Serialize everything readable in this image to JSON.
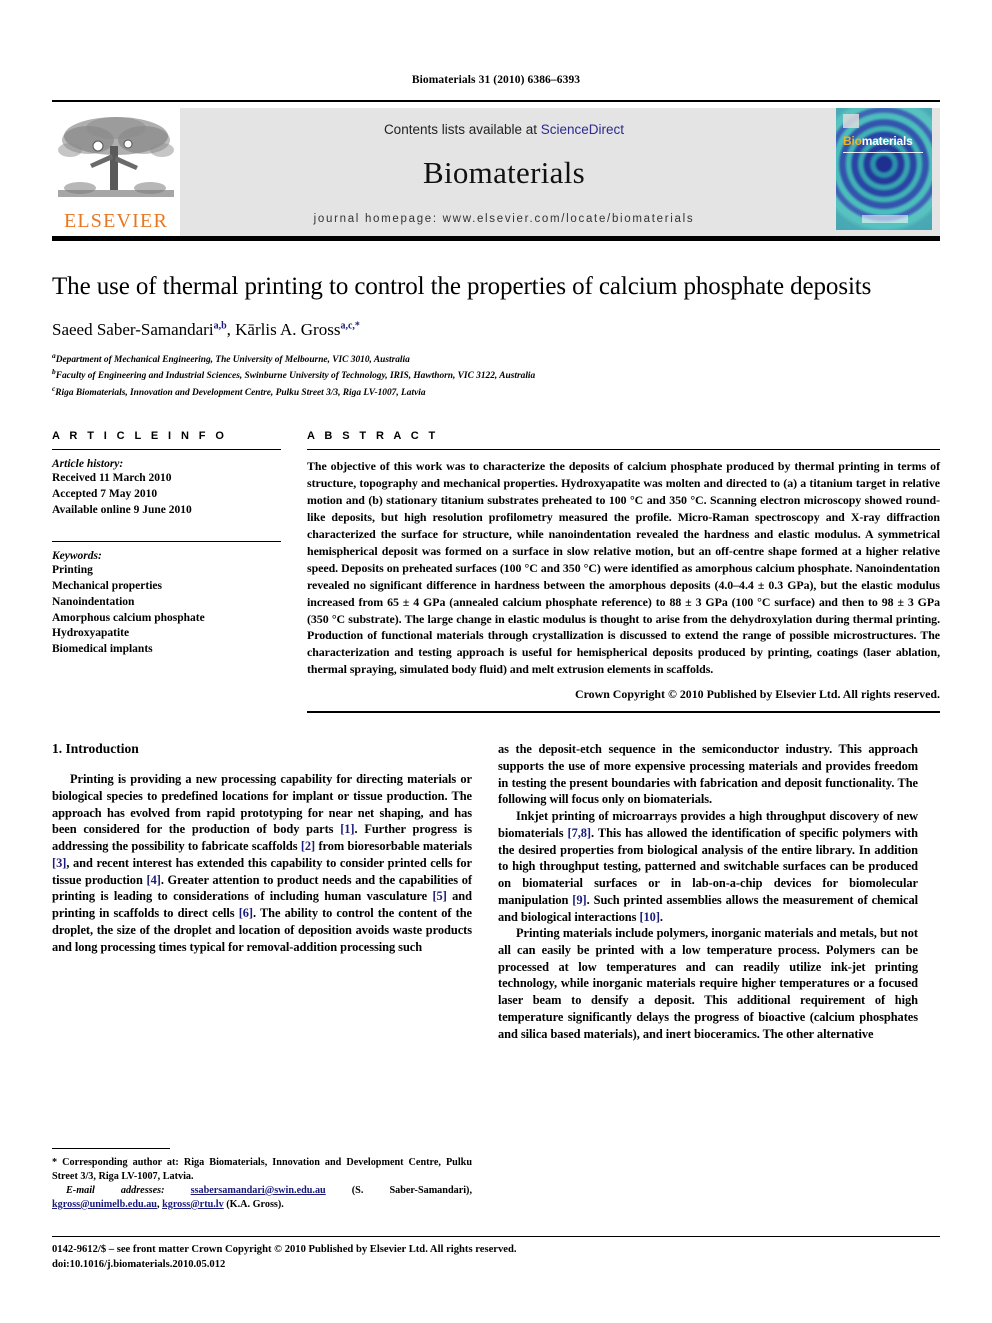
{
  "running_head": "Biomaterials 31 (2010) 6386–6393",
  "masthead": {
    "publisher_wordmark": "ELSEVIER",
    "contents_prefix": "Contents lists available at ",
    "contents_link": "ScienceDirect",
    "journal_title": "Biomaterials",
    "homepage_line": "journal homepage: www.elsevier.com/locate/biomaterials",
    "cover": {
      "title_part1": "Bio",
      "title_part2": "materials"
    },
    "accent_link_color": "#2b2b8f",
    "elsevier_orange": "#E87722",
    "banner_bg": "#e4e4e4"
  },
  "article": {
    "title": "The use of thermal printing to control the properties of calcium phosphate deposits",
    "authors_part1": "Saeed Saber-Samandari",
    "authors_sup1": "a,b",
    "authors_sep": ", ",
    "authors_part2": "Kārlis A. Gross",
    "authors_sup2": "a,c,*",
    "affiliations": [
      {
        "marker": "a",
        "text": "Department of Mechanical Engineering, The University of Melbourne, VIC 3010, Australia"
      },
      {
        "marker": "b",
        "text": "Faculty of Engineering and Industrial Sciences, Swinburne University of Technology, IRIS, Hawthorn, VIC 3122, Australia"
      },
      {
        "marker": "c",
        "text": "Riga Biomaterials, Innovation and Development Centre, Pulku Street 3/3, Riga LV-1007, Latvia"
      }
    ]
  },
  "article_info": {
    "kicker": "A R T I C L E   I N F O",
    "history_head": "Article history:",
    "history": [
      "Received 11 March 2010",
      "Accepted 7 May 2010",
      "Available online 9 June 2010"
    ],
    "keywords_head": "Keywords:",
    "keywords": [
      "Printing",
      "Mechanical properties",
      "Nanoindentation",
      "Amorphous calcium phosphate",
      "Hydroxyapatite",
      "Biomedical implants"
    ]
  },
  "abstract": {
    "kicker": "A B S T R A C T",
    "text": "The objective of this work was to characterize the deposits of calcium phosphate produced by thermal printing in terms of structure, topography and mechanical properties. Hydroxyapatite was molten and directed to (a) a titanium target in relative motion and (b) stationary titanium substrates preheated to 100 °C and 350 °C. Scanning electron microscopy showed round-like deposits, but high resolution profilometry measured the profile. Micro-Raman spectroscopy and X-ray diffraction characterized the surface for structure, while nanoindentation revealed the hardness and elastic modulus. A symmetrical hemispherical deposit was formed on a surface in slow relative motion, but an off-centre shape formed at a higher relative speed. Deposits on preheated surfaces (100 °C and 350 °C) were identified as amorphous calcium phosphate. Nanoindentation revealed no significant difference in hardness between the amorphous deposits (4.0–4.4 ± 0.3 GPa), but the elastic modulus increased from 65 ± 4 GPa (annealed calcium phosphate reference) to 88 ± 3 GPa (100 °C surface) and then to 98 ± 3 GPa (350 °C substrate). The large change in elastic modulus is thought to arise from the dehydroxylation during thermal printing. Production of functional materials through crystallization is discussed to extend the range of possible microstructures. The characterization and testing approach is useful for hemispherical deposits produced by printing, coatings (laser ablation, thermal spraying, simulated body fluid) and melt extrusion elements in scaffolds.",
    "copyright": "Crown Copyright © 2010 Published by Elsevier Ltd. All rights reserved."
  },
  "introduction": {
    "heading": "1. Introduction",
    "left_paragraph_1_a": "Printing is providing a new processing capability for directing materials or biological species to predefined locations for implant or tissue production. The approach has evolved from rapid prototyping for near net shaping, and has been considered for the production of body parts ",
    "ref1": "[1]",
    "left_paragraph_1_b": ". Further progress is addressing the possibility to fabricate scaffolds ",
    "ref2": "[2]",
    "left_paragraph_1_c": " from bioresorbable materials ",
    "ref3": "[3]",
    "left_paragraph_1_d": ", and recent interest has extended this capability to consider printed cells for tissue production ",
    "ref4": "[4]",
    "left_paragraph_1_e": ". Greater attention to product needs and the capabilities of printing is leading to considerations of including human vasculature ",
    "ref5": "[5]",
    "left_paragraph_1_f": " and printing in scaffolds to direct cells ",
    "ref6": "[6]",
    "left_paragraph_1_g": ". The ability to control the content of the droplet, the size of the droplet and location of deposition avoids waste products and long processing times typical for removal-addition processing such",
    "right_paragraph_1": "as the deposit-etch sequence in the semiconductor industry. This approach supports the use of more expensive processing materials and provides freedom in testing the present boundaries with fabrication and deposit functionality. The following will focus only on biomaterials.",
    "right_paragraph_2_a": "Inkjet printing of microarrays provides a high throughput discovery of new biomaterials ",
    "ref78": "[7,8]",
    "right_paragraph_2_b": ". This has allowed the identification of specific polymers with the desired properties from biological analysis of the entire library. In addition to high throughput testing, patterned and switchable surfaces can be produced on biomaterial surfaces or in lab-on-a-chip devices for biomolecular manipulation ",
    "ref9": "[9]",
    "right_paragraph_2_c": ". Such printed assemblies allows the measurement of chemical and biological interactions ",
    "ref10": "[10]",
    "right_paragraph_2_d": ".",
    "right_paragraph_3": "Printing materials include polymers, inorganic materials and metals, but not all can easily be printed with a low temperature process. Polymers can be processed at low temperatures and can readily utilize ink-jet printing technology, while inorganic materials require higher temperatures or a focused laser beam to densify a deposit. This additional requirement of high temperature significantly delays the progress of bioactive (calcium phosphates and silica based materials), and inert bioceramics. The other alternative"
  },
  "footnote": {
    "corresponding": "* Corresponding author at: Riga Biomaterials, Innovation and Development Centre, Pulku Street 3/3, Riga LV-1007, Latvia.",
    "email_label": "E-mail addresses:",
    "email1": "ssabersamandari@swin.edu.au",
    "email1_name": " (S. Saber-Samandari), ",
    "email2": "kgross@unimelb.edu.au",
    "email_sep": ", ",
    "email3": "kgross@rtu.lv",
    "email3_name": " (K.A. Gross)."
  },
  "footer": {
    "issn_line": "0142-9612/$ – see front matter Crown Copyright © 2010 Published by Elsevier Ltd. All rights reserved.",
    "doi_line": "doi:10.1016/j.biomaterials.2010.05.012"
  }
}
